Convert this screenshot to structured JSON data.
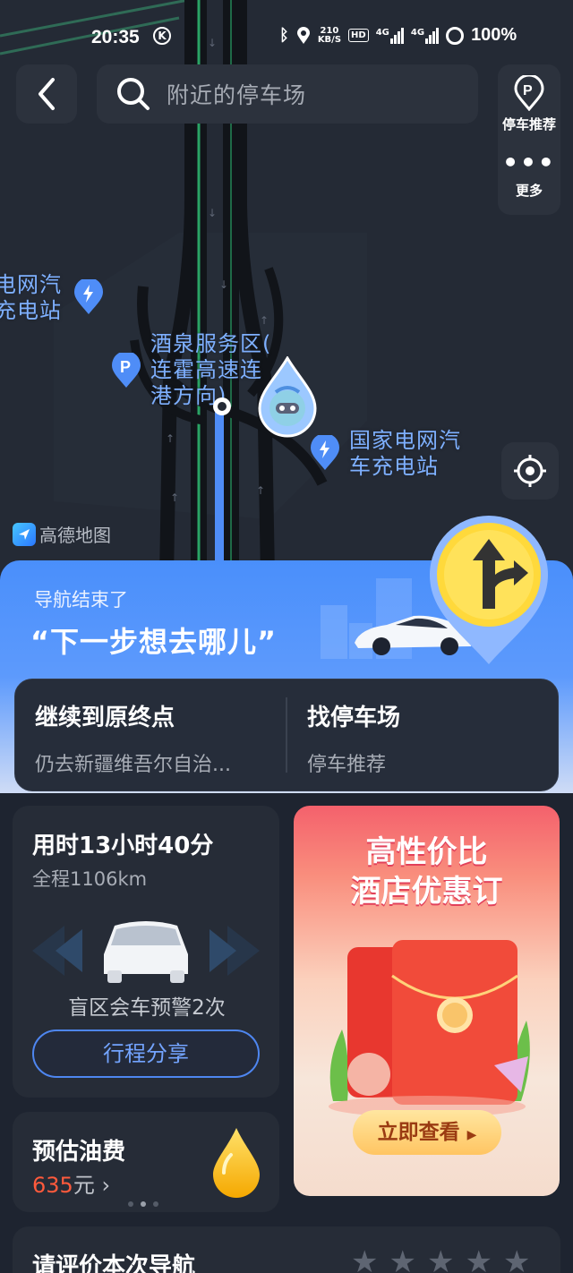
{
  "status_bar": {
    "time": "20:35",
    "net_speed_value": "210",
    "net_speed_unit": "KB/S",
    "hd_label": "HD",
    "network_label_1": "4G",
    "network_label_2": "4G",
    "battery": "100%"
  },
  "search": {
    "placeholder": "附近的停车场"
  },
  "side_panel": {
    "parking_label": "停车推荐",
    "more_label": "更多"
  },
  "map": {
    "labels": {
      "charging_station_left": [
        "电网汽",
        "充电站"
      ],
      "service_area": [
        "酒泉服务区(",
        "连霍高速连",
        "港方向)"
      ],
      "charging_station_right": [
        "国家电网汽",
        "车充电站"
      ]
    },
    "attribution": "高德地图"
  },
  "nav_end": {
    "title": "导航结束了",
    "subtitle": "“下一步想去哪儿”"
  },
  "actions": {
    "continue": {
      "title": "继续到原终点",
      "subtitle": "仍去新疆维吾尔自治..."
    },
    "parking": {
      "title": "找停车场",
      "subtitle": "停车推荐"
    }
  },
  "trip": {
    "duration": "用时13小时40分",
    "distance": "全程1106km",
    "warning": "盲区会车预警2次",
    "share_label": "行程分享"
  },
  "ad": {
    "headline_1": "高性价比",
    "headline_2": "酒店优惠订",
    "cta": "立即查看"
  },
  "fuel": {
    "title": "预估油费",
    "amount": "635",
    "unit": "元",
    "page_count": 3,
    "active_page": 2
  },
  "rating": {
    "title": "请评价本次导航",
    "stars": 5
  },
  "colors": {
    "primary_blue": "#4a8ffb",
    "fuel_price": "#ff5a3c",
    "map_bg": "#242a35",
    "card_bg": "#262c37"
  }
}
